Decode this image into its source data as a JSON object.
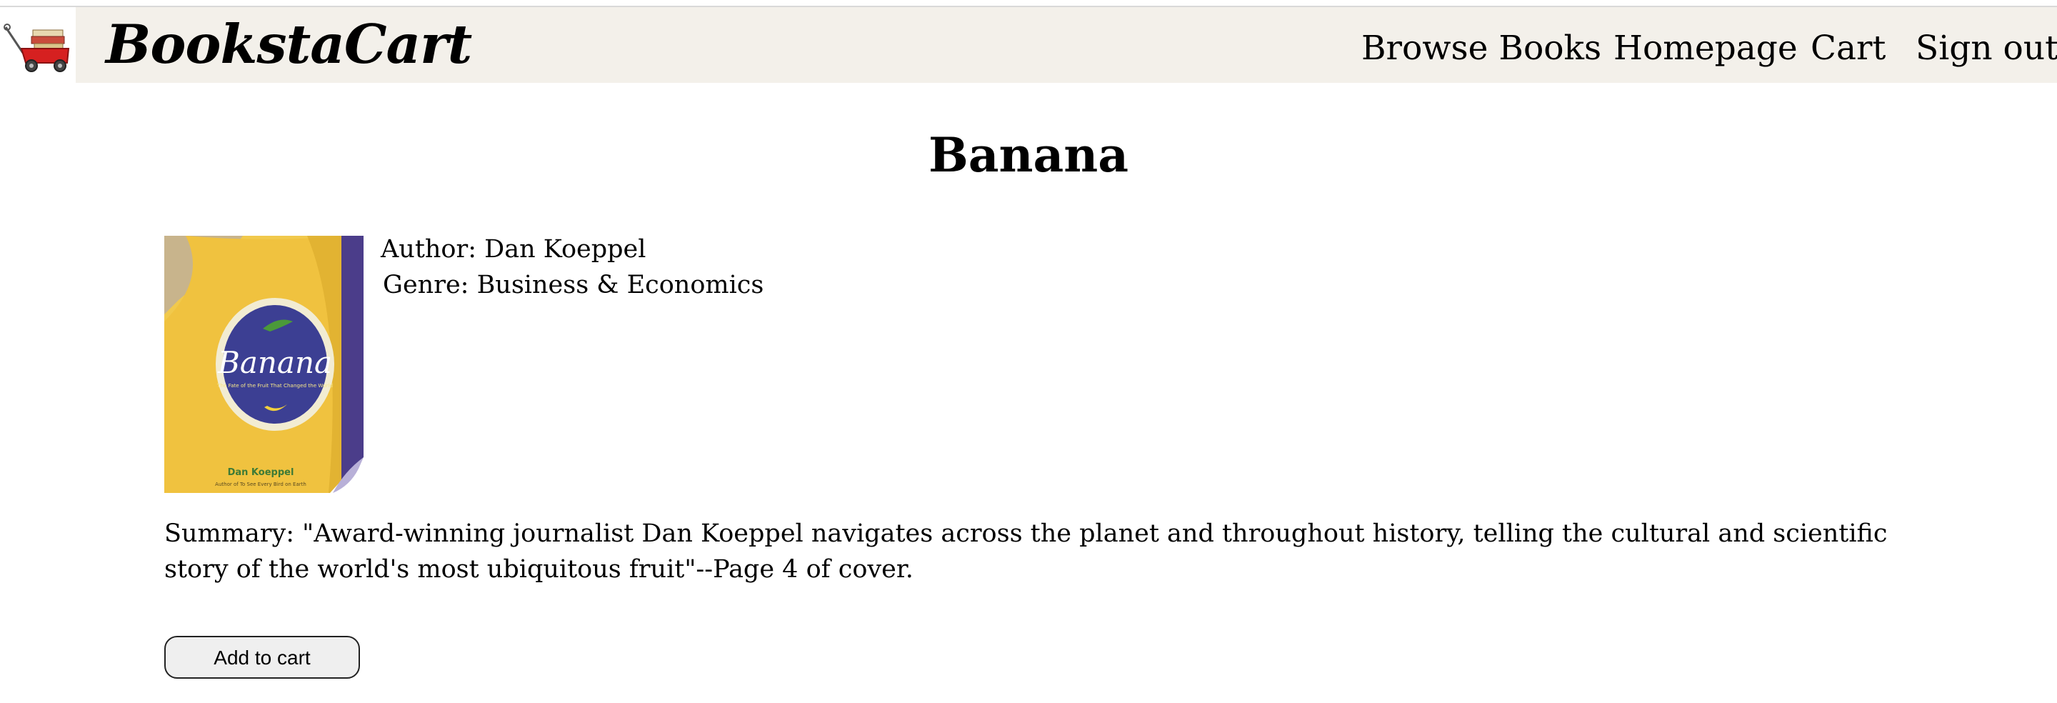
{
  "header": {
    "logo_icon": "red-wagon-with-books-icon",
    "brand": "BookstaCart",
    "nav": [
      {
        "label": "Browse Books"
      },
      {
        "label": "Homepage"
      },
      {
        "label": "Cart"
      },
      {
        "label": "Sign out"
      }
    ]
  },
  "book": {
    "title": "Banana",
    "author_line": "Author: Dan Koeppel",
    "genre_line": "Genre: Business & Economics",
    "summary": "Summary: \"Award-winning journalist Dan Koeppel navigates across the planet and throughout history, telling the cultural and scientific story of the world's most ubiquitous fruit\"--Page 4 of cover.",
    "cover": {
      "title_text": "Banana",
      "subtitle_text": "The Fate of the Fruit That Changed the World",
      "author_text": "Dan Koeppel",
      "byline_text": "Author of To See Every Bird on Earth"
    }
  },
  "actions": {
    "add_to_cart_label": "Add to cart"
  },
  "colors": {
    "navbar_bg": "#f3f0ea",
    "cover_yellow": "#f0c84a",
    "cover_purple": "#3f3f8f"
  }
}
